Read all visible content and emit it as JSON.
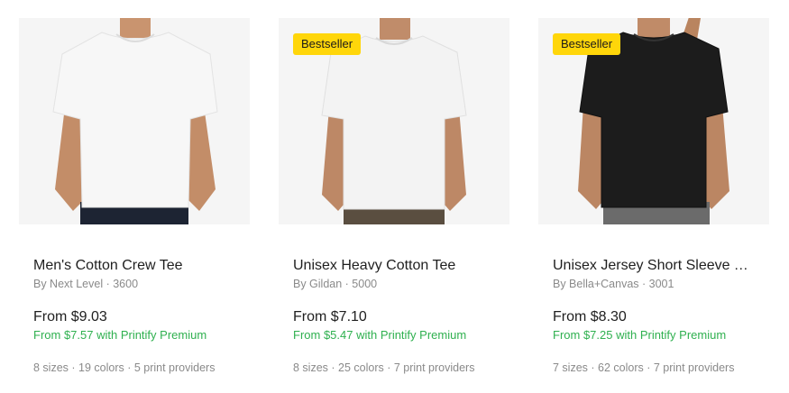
{
  "products": [
    {
      "title": "Men's Cotton Crew Tee",
      "brand": "By Next Level · 3600",
      "price": "From $9.03",
      "premium_price": "From $7.57 with Printify Premium",
      "meta": "8 sizes · 19 colors · 5 print providers",
      "badge": "",
      "shirt_color": "#f7f7f7",
      "pants_color": "#1d2433"
    },
    {
      "title": "Unisex Heavy Cotton Tee",
      "brand": "By Gildan · 5000",
      "price": "From $7.10",
      "premium_price": "From $5.47 with Printify Premium",
      "meta": "8 sizes · 25 colors · 7 print providers",
      "badge": "Bestseller",
      "shirt_color": "#f3f3f3",
      "pants_color": "#5a4e40"
    },
    {
      "title": "Unisex Jersey Short Sleeve Tee",
      "brand": "By Bella+Canvas · 3001",
      "price": "From $8.30",
      "premium_price": "From $7.25 with Printify Premium",
      "meta": "7 sizes · 62 colors · 7 print providers",
      "badge": "Bestseller",
      "shirt_color": "#1c1c1c",
      "pants_color": "#6b6b6b"
    }
  ],
  "colors": {
    "badge_bg": "#ffd60a",
    "premium_text": "#2fb04f"
  }
}
